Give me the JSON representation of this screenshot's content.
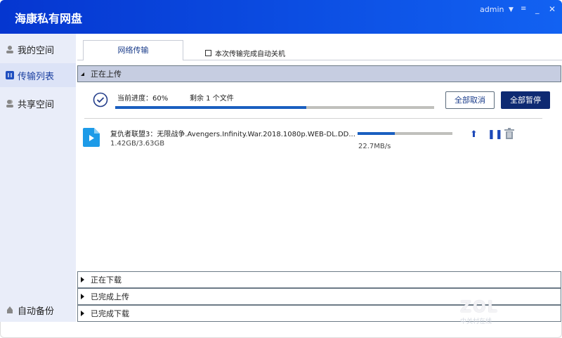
{
  "window": {
    "title": "海康私有网盘",
    "user": "admin"
  },
  "sidebar": {
    "items": [
      {
        "label": "我的空间"
      },
      {
        "label": "传输列表"
      },
      {
        "label": "共享空间"
      },
      {
        "label": "自动备份"
      }
    ]
  },
  "tabs": {
    "active": "网络传输",
    "auto_shutdown": "本次传输完成自动关机",
    "auto_shutdown_checked": false
  },
  "uploading": {
    "header": "正在上传",
    "progress_label": "当前进度：60%",
    "progress": 0.6,
    "remaining": "剩余 1 个文件",
    "cancel_all": "全部取消",
    "pause_all": "全部暂停",
    "files": [
      {
        "name": "复仇者联盟3：无限战争.Avengers.Infinity.War.2018.1080p.WEB-DL.DD...",
        "size": "1.42GB/3.63GB",
        "progress": 0.39,
        "speed": "22.7MB/s"
      }
    ]
  },
  "sections": [
    {
      "label": "正在下载"
    },
    {
      "label": "已完成上传"
    },
    {
      "label": "已完成下载"
    }
  ],
  "watermark": {
    "logo": "ZOL",
    "sub": "中关村在线"
  },
  "colors": {
    "title": "#0a45e0",
    "accent": "#1a5fc0",
    "button_dark": "#0e2a72"
  }
}
